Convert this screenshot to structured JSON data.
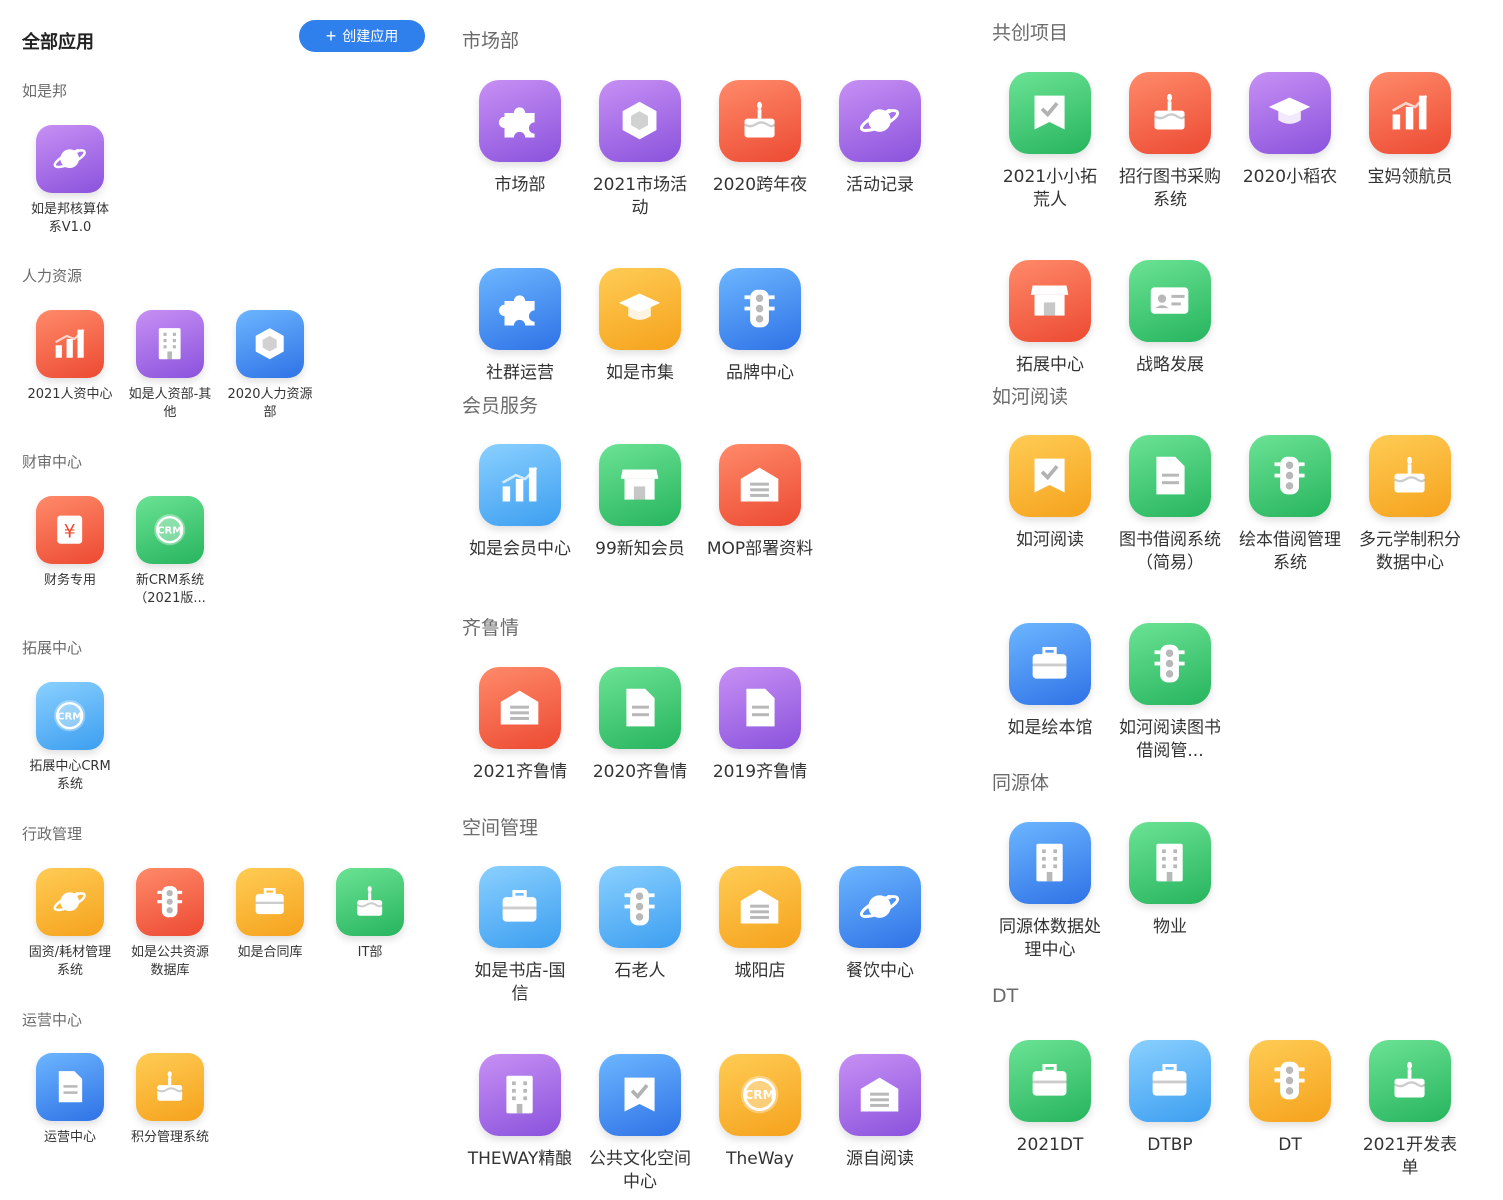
{
  "header": {
    "title": "全部应用",
    "create_label": "创建应用",
    "create_icon": "plus-icon"
  },
  "colors": {
    "accent": "#2f80ed",
    "purple": "#9a5ee6",
    "orange": "#f2583c",
    "blue": "#3a86f0",
    "green": "#35c46c",
    "yellow": "#f7b02e",
    "sky": "#4aaaf5"
  },
  "col1": [
    {
      "title": "如是邦",
      "apps": [
        {
          "label": "如是邦核算体系V1.0",
          "color": "purple",
          "icon": "planet"
        }
      ]
    },
    {
      "title": "人力资源",
      "apps": [
        {
          "label": "2021人资中心",
          "color": "orange",
          "icon": "chart"
        },
        {
          "label": "如是人资部-其他",
          "color": "purple",
          "icon": "building"
        },
        {
          "label": "2020人力资源部",
          "color": "blue",
          "icon": "cube"
        }
      ]
    },
    {
      "title": "财审中心",
      "apps": [
        {
          "label": "财务专用",
          "color": "orange",
          "icon": "money"
        },
        {
          "label": "新CRM系统（2021版...",
          "color": "green",
          "icon": "crm"
        }
      ]
    },
    {
      "title": "拓展中心",
      "apps": [
        {
          "label": "拓展中心CRM系统",
          "color": "sky",
          "icon": "crm"
        }
      ]
    },
    {
      "title": "行政管理",
      "apps": [
        {
          "label": "固资/耗材管理系统",
          "color": "yellow",
          "icon": "planet"
        },
        {
          "label": "如是公共资源数据库",
          "color": "orange",
          "icon": "traffic"
        },
        {
          "label": "如是合同库",
          "color": "yellow",
          "icon": "briefcase"
        },
        {
          "label": "IT部",
          "color": "green",
          "icon": "cake"
        }
      ]
    },
    {
      "title": "运营中心",
      "apps": [
        {
          "label": "运营中心",
          "color": "blue",
          "icon": "doc"
        },
        {
          "label": "积分管理系统",
          "color": "yellow",
          "icon": "cake"
        }
      ]
    }
  ],
  "col2": [
    {
      "title": "市场部",
      "apps": [
        {
          "label": "市场部",
          "color": "purple",
          "icon": "puzzle"
        },
        {
          "label": "2021市场活动",
          "color": "purple",
          "icon": "cube"
        },
        {
          "label": "2020跨年夜",
          "color": "orange",
          "icon": "cake"
        },
        {
          "label": "活动记录",
          "color": "purple",
          "icon": "planet"
        },
        {
          "label": "社群运营",
          "color": "blue",
          "icon": "puzzle"
        },
        {
          "label": "如是市集",
          "color": "yellow",
          "icon": "cap"
        },
        {
          "label": "品牌中心",
          "color": "blue",
          "icon": "traffic"
        }
      ]
    },
    {
      "title": "会员服务",
      "apps": [
        {
          "label": "如是会员中心",
          "color": "sky",
          "icon": "chart"
        },
        {
          "label": "99新知会员",
          "color": "green",
          "icon": "store"
        },
        {
          "label": "MOP部署资料",
          "color": "orange",
          "icon": "garage"
        }
      ]
    },
    {
      "title": "齐鲁情",
      "apps": [
        {
          "label": "2021齐鲁情",
          "color": "orange",
          "icon": "garage"
        },
        {
          "label": "2020齐鲁情",
          "color": "green",
          "icon": "doc"
        },
        {
          "label": "2019齐鲁情",
          "color": "purple",
          "icon": "doc"
        }
      ]
    },
    {
      "title": "空间管理",
      "apps": [
        {
          "label": "如是书店-国信",
          "color": "sky",
          "icon": "briefcase"
        },
        {
          "label": "石老人",
          "color": "sky",
          "icon": "traffic"
        },
        {
          "label": "城阳店",
          "color": "yellow",
          "icon": "garage"
        },
        {
          "label": "餐饮中心",
          "color": "blue",
          "icon": "planet"
        },
        {
          "label": "THEWAY精酿",
          "color": "purple",
          "icon": "building"
        },
        {
          "label": "公共文化空间中心",
          "color": "blue",
          "icon": "check"
        },
        {
          "label": "TheWay",
          "color": "yellow",
          "icon": "crm"
        },
        {
          "label": "源自阅读",
          "color": "purple",
          "icon": "garage"
        }
      ]
    }
  ],
  "col3": [
    {
      "title": "共创项目",
      "apps": [
        {
          "label": "2021小小拓荒人",
          "color": "green",
          "icon": "check"
        },
        {
          "label": "招行图书采购系统",
          "color": "orange",
          "icon": "cake"
        },
        {
          "label": "2020小稻农",
          "color": "purple",
          "icon": "cap"
        },
        {
          "label": "宝妈领航员",
          "color": "orange",
          "icon": "chart"
        },
        {
          "label": "拓展中心",
          "color": "orange",
          "icon": "store"
        },
        {
          "label": "战略发展",
          "color": "green",
          "icon": "idcard"
        }
      ]
    },
    {
      "title": "如河阅读",
      "apps": [
        {
          "label": "如河阅读",
          "color": "yellow",
          "icon": "check"
        },
        {
          "label": "图书借阅系统（简易）",
          "color": "green",
          "icon": "doc"
        },
        {
          "label": "绘本借阅管理系统",
          "color": "green",
          "icon": "traffic"
        },
        {
          "label": "多元学制积分数据中心",
          "color": "yellow",
          "icon": "cake"
        },
        {
          "label": "如是绘本馆",
          "color": "blue",
          "icon": "briefcase"
        },
        {
          "label": "如河阅读图书借阅管...",
          "color": "green",
          "icon": "traffic"
        }
      ]
    },
    {
      "title": "同源体",
      "apps": [
        {
          "label": "同源体数据处理中心",
          "color": "blue",
          "icon": "building"
        },
        {
          "label": "物业",
          "color": "green",
          "icon": "building"
        }
      ]
    },
    {
      "title": "DT",
      "apps": [
        {
          "label": "2021DT",
          "color": "green",
          "icon": "briefcase"
        },
        {
          "label": "DTBP",
          "color": "sky",
          "icon": "briefcase"
        },
        {
          "label": "DT",
          "color": "yellow",
          "icon": "traffic"
        },
        {
          "label": "2021开发表单",
          "color": "green",
          "icon": "cake"
        }
      ]
    }
  ]
}
